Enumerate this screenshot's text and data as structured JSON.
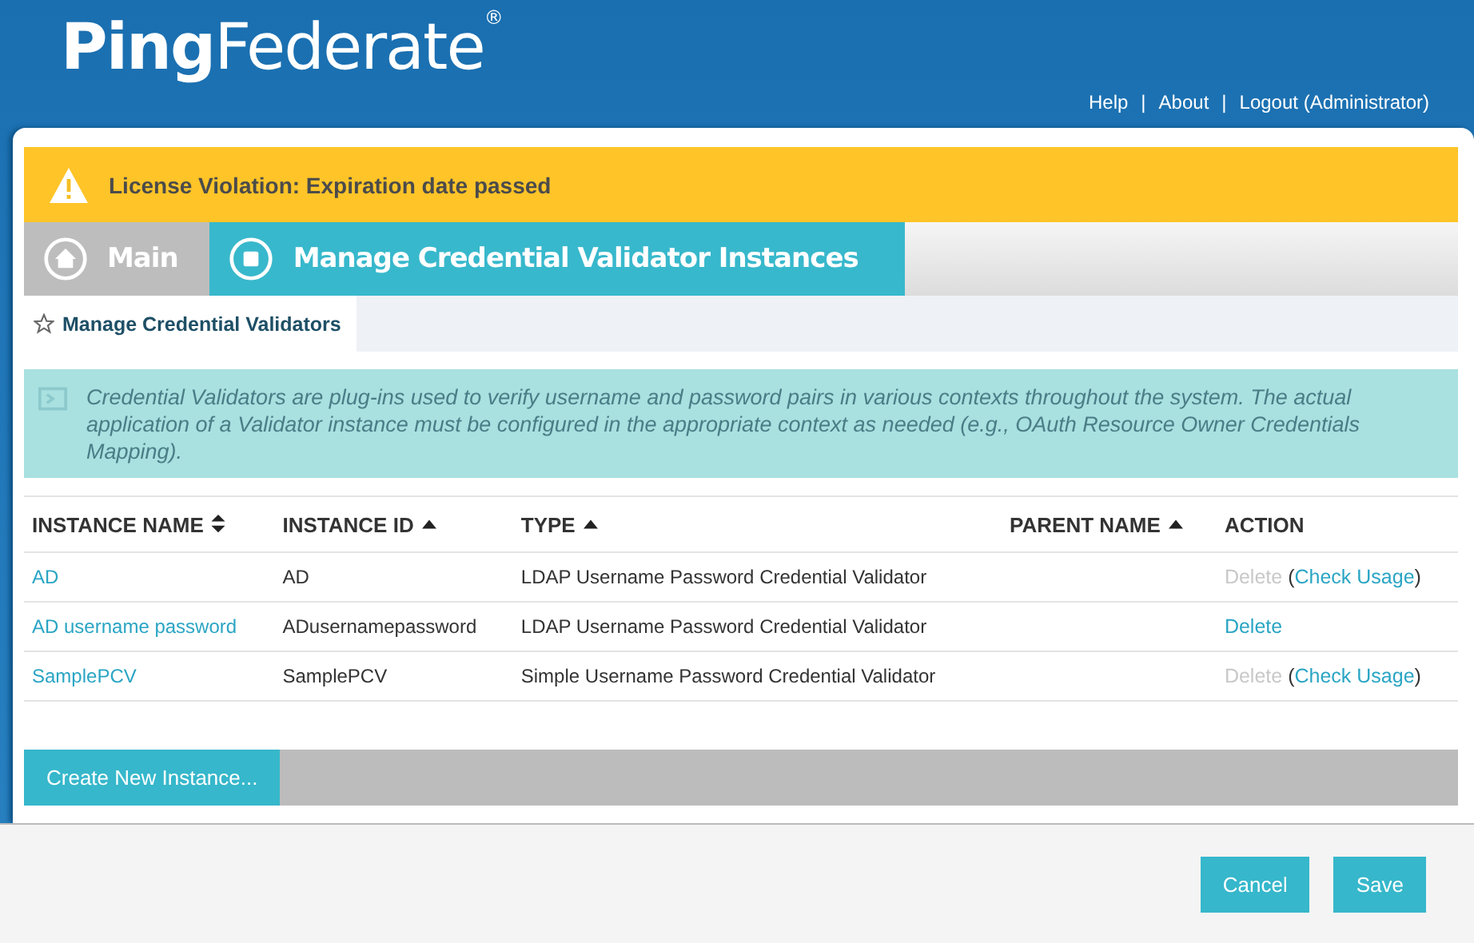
{
  "header": {
    "logo": "**Ping**Federate$^{®}$",
    "links": [
      {
        "label": "Help"
      },
      {
        "label": "About"
      },
      {
        "label": "Logout (Administrator)"
      }
    ],
    "separator": "|"
  },
  "alert": {
    "text": "License Violation: Expiration date passed"
  },
  "tabs": [
    {
      "label": "Main",
      "selected": false
    },
    {
      "label": "Manage Credential Validator Instances",
      "selected": true
    }
  ],
  "subtabs": [
    {
      "label": "Manage Credential Validators",
      "selected": true
    }
  ],
  "info": "Credential Validators are plug-ins used to verify username and password pairs in various contexts throughout the system. The actual application of a Validator instance must be configured in the appropriate context as needed (e.g., OAuth Resource Owner Credentials Mapping).",
  "table": {
    "columns": [
      {
        "label": "INSTANCE NAME",
        "kind": "sortboth"
      },
      {
        "label": "INSTANCE ID",
        "kind": "sortasc"
      },
      {
        "label": "TYPE",
        "kind": "sortasc"
      },
      {
        "label": "PARENT NAME",
        "kind": "sortasc"
      },
      {
        "label": "ACTION",
        "kind": "plain"
      }
    ],
    "rows": [
      {
        "name": "AD",
        "id": "AD",
        "type": "LDAP Username Password Credential Validator",
        "delete": {
          "label": "Delete",
          "disabled": true
        },
        "check_usage": {
          "open": "(",
          "link": "Check Usage",
          "close": ")"
        }
      },
      {
        "name": "AD username password",
        "id": "ADusernamepassword",
        "type": "LDAP Username Password Credential Validator",
        "delete": {
          "label": "Delete",
          "disabled": false
        }
      },
      {
        "name": "SamplePCV",
        "id": "SamplePCV",
        "type": "Simple Username Password Credential Validator",
        "delete": {
          "label": "Delete",
          "disabled": true
        },
        "check_usage": {
          "open": "(",
          "link": "Check Usage",
          "close": ")"
        }
      }
    ]
  },
  "create_button": "Create New Instance...",
  "footer_buttons": [
    {
      "label": "Cancel"
    },
    {
      "label": "Save"
    }
  ]
}
